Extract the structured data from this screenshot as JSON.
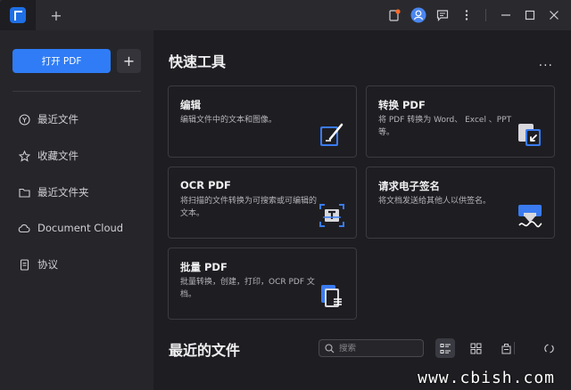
{
  "titlebar": {
    "new_tab_symbol": "+"
  },
  "sidebar": {
    "open_pdf_label": "打开 PDF",
    "add_symbol": "+",
    "items": [
      {
        "label": "最近文件",
        "icon": "recent-icon"
      },
      {
        "label": "收藏文件",
        "icon": "star-icon"
      },
      {
        "label": "最近文件夹",
        "icon": "folder-icon"
      },
      {
        "label": "Document Cloud",
        "icon": "cloud-icon"
      },
      {
        "label": "协议",
        "icon": "document-icon"
      }
    ]
  },
  "quick_tools": {
    "title": "快速工具",
    "more": "...",
    "cards": [
      {
        "title": "编辑",
        "desc": "编辑文件中的文本和图像。",
        "icon": "edit-icon"
      },
      {
        "title": "转换 PDF",
        "desc": "将 PDF 转换为 Word、 Excel 、PPT等。",
        "icon": "convert-icon"
      },
      {
        "title": "OCR PDF",
        "desc": "将扫描的文件转换为可搜索或可编辑的文本。",
        "icon": "ocr-icon"
      },
      {
        "title": "请求电子签名",
        "desc": "将文档发送给其他人以供签名。",
        "icon": "signature-icon"
      },
      {
        "title": "批量 PDF",
        "desc": "批量转换，创建，打印，OCR PDF 文档。",
        "icon": "batch-icon"
      }
    ]
  },
  "recent": {
    "title": "最近的文件",
    "search_placeholder": "搜索"
  },
  "watermark": "www.cbish.com",
  "colors": {
    "accent": "#2f7cf6",
    "background": "#1e1e22",
    "sidebar": "#26262a",
    "titlebar": "#2a2a2e",
    "notify": "#ff6a2a"
  }
}
